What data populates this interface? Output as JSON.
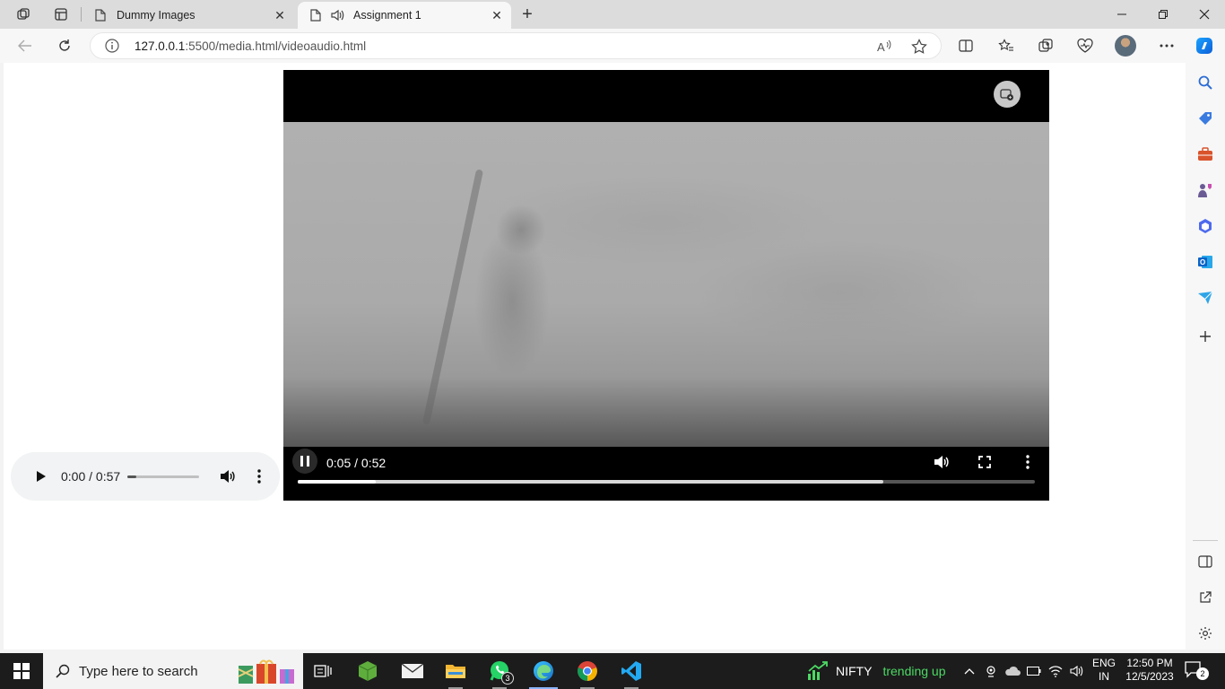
{
  "browser": {
    "tabs": [
      {
        "title": "Dummy Images",
        "active": false
      },
      {
        "title": "Assignment 1",
        "active": true
      }
    ],
    "url_host": "127.0.0.1",
    "url_rest": ":5500/media.html/videoaudio.html"
  },
  "audio_player": {
    "time": "0:00 / 0:57",
    "volume_fraction": 0.12
  },
  "video_player": {
    "time": "0:05 / 0:52",
    "played_fraction": 0.106,
    "buffered_fraction": 0.794
  },
  "taskbar": {
    "search_placeholder": "Type here to search",
    "whatsapp_badge": "3",
    "nifty_label": "NIFTY",
    "nifty_status": "trending up",
    "lang_line1": "ENG",
    "lang_line2": "IN",
    "time": "12:50 PM",
    "date": "12/5/2023",
    "notification_count": "2"
  },
  "colors": {
    "accent": "#0078d4",
    "trend_green": "#4cd964"
  }
}
